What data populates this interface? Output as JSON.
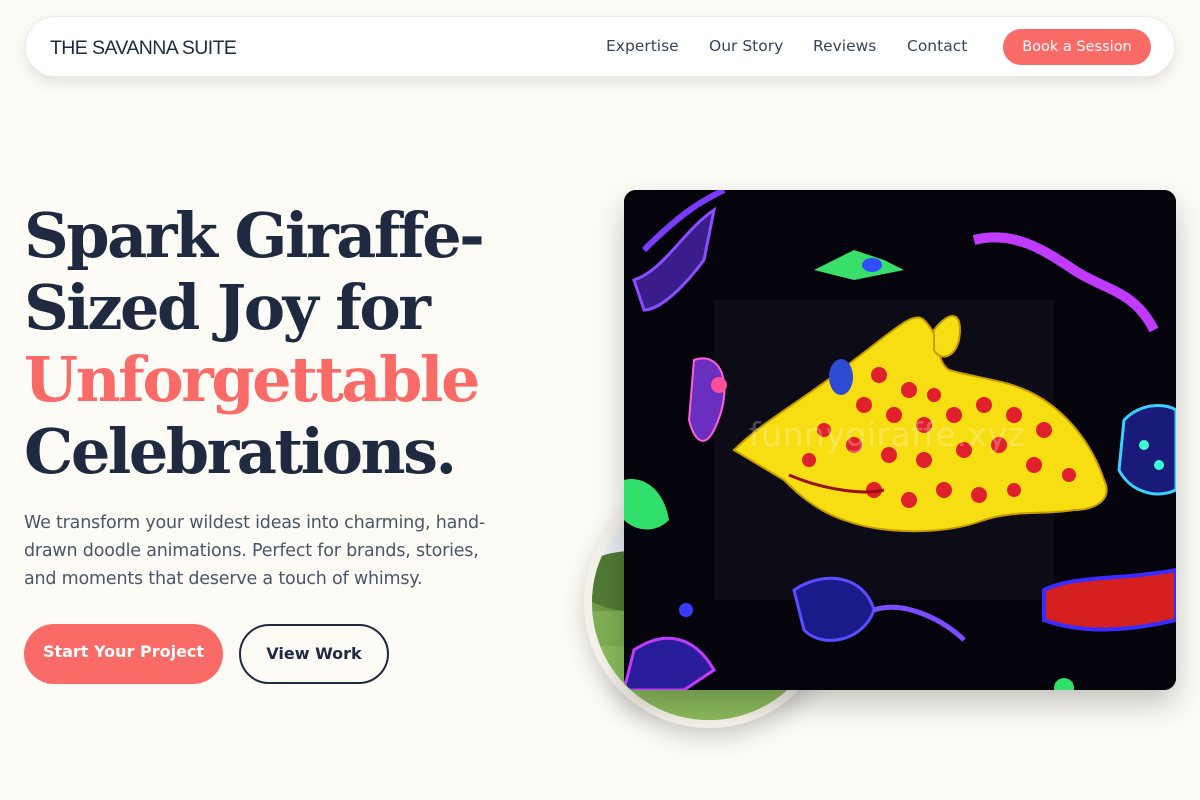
{
  "nav": {
    "brand": "THE SAVANNA SUITE",
    "links": [
      {
        "label": "Expertise"
      },
      {
        "label": "Our Story"
      },
      {
        "label": "Reviews"
      },
      {
        "label": "Contact"
      }
    ],
    "cta_label": "Book a Session"
  },
  "hero": {
    "headline_lines": [
      "Spark Giraffe-",
      "Sized Joy for",
      "Unforgettable",
      "Celebrations."
    ],
    "subtext_lines": [
      "We transform your wildest ideas into charming, hand-",
      "drawn doodle animations. Perfect for brands, stories,",
      "and moments that deserve a touch of whimsy."
    ],
    "primary_cta": "Start Your Project",
    "secondary_cta": "View Work"
  },
  "media": {
    "main_image_watermark": "funnygiraffe.xyz"
  },
  "colors": {
    "accent": "#fa6b68",
    "text_dark": "#1f2a40",
    "background": "#fcfbf5"
  }
}
